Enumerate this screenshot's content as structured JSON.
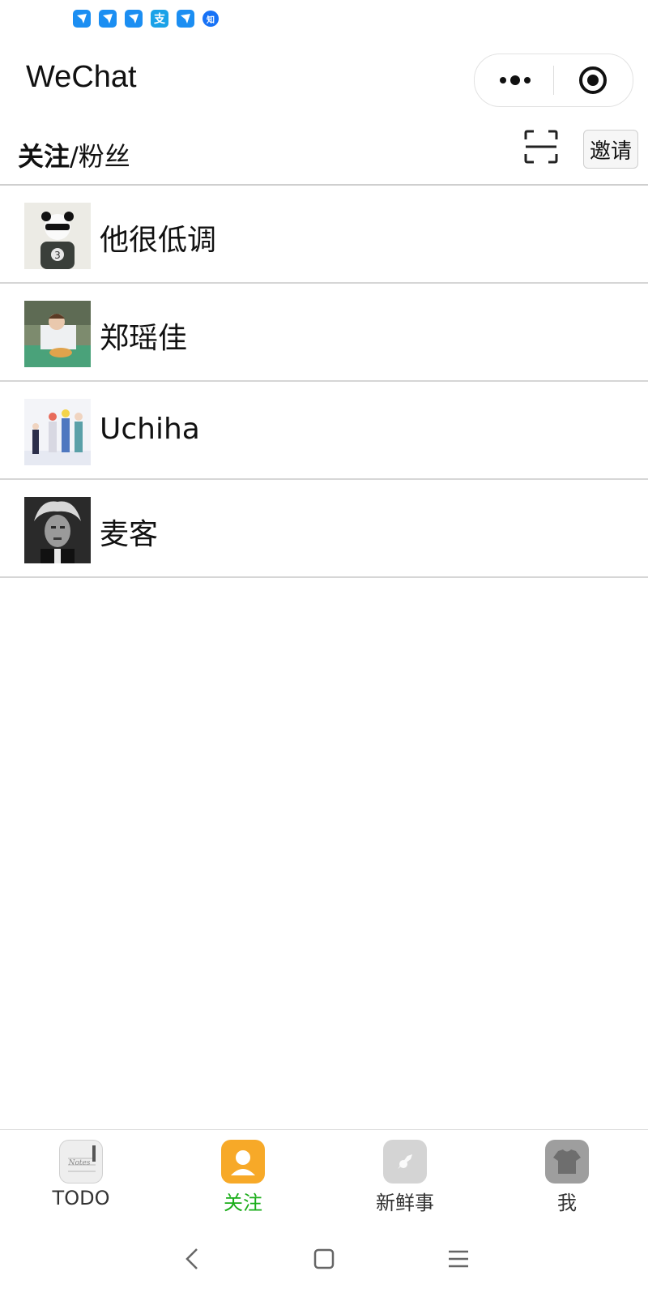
{
  "status_bar": {
    "icons": [
      "feishu-icon",
      "feishu-icon",
      "feishu-icon",
      "alipay-icon",
      "feishu-icon",
      "zhihu-icon"
    ],
    "alipay_glyph": "支",
    "zhihu_glyph": "知"
  },
  "titlebar": {
    "title": "WeChat"
  },
  "header": {
    "title_bold": "关注",
    "title_rest": "/粉丝",
    "invite_label": "邀请"
  },
  "users": [
    {
      "name": "他很低调",
      "avatar": "panda-avatar"
    },
    {
      "name": "郑瑶佳",
      "avatar": "photo-avatar"
    },
    {
      "name": "Uchiha",
      "avatar": "anime-avatar"
    },
    {
      "name": "麦客",
      "avatar": "bw-portrait-avatar"
    }
  ],
  "tabbar": {
    "tabs": [
      {
        "label": "TODO",
        "icon": "notes-icon",
        "active": false
      },
      {
        "label": "关注",
        "icon": "person-icon",
        "active": true
      },
      {
        "label": "新鲜事",
        "icon": "compass-icon",
        "active": false
      },
      {
        "label": "我",
        "icon": "shirt-icon",
        "active": false
      }
    ]
  },
  "colors": {
    "accent": "#1aad19",
    "active_tab_icon": "#f7a928",
    "status_icon": "#1b8ef2"
  }
}
